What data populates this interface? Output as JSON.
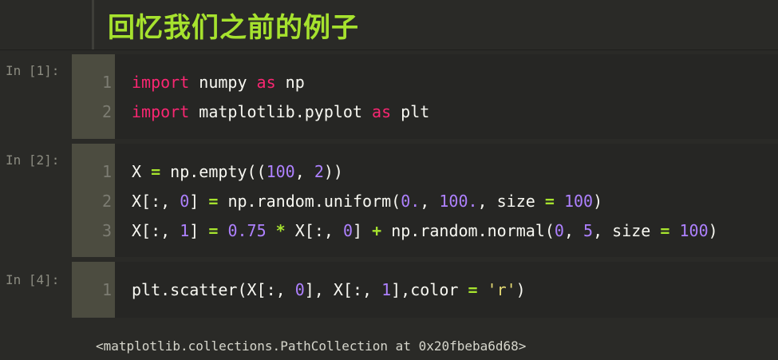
{
  "heading": {
    "text": "回忆我们之前的例子"
  },
  "cells": [
    {
      "prompt": "In [1]:",
      "lines": [
        {
          "n": "1",
          "tokens": [
            {
              "t": "import",
              "c": "kw"
            },
            {
              "t": " numpy ",
              "c": ""
            },
            {
              "t": "as",
              "c": "kw"
            },
            {
              "t": " np",
              "c": ""
            }
          ]
        },
        {
          "n": "2",
          "tokens": [
            {
              "t": "import",
              "c": "kw"
            },
            {
              "t": " matplotlib.pyplot ",
              "c": ""
            },
            {
              "t": "as",
              "c": "kw"
            },
            {
              "t": " plt",
              "c": ""
            }
          ]
        }
      ]
    },
    {
      "prompt": "In [2]:",
      "lines": [
        {
          "n": "1",
          "tokens": [
            {
              "t": "X ",
              "c": ""
            },
            {
              "t": "=",
              "c": "op"
            },
            {
              "t": " np.empty((",
              "c": ""
            },
            {
              "t": "100",
              "c": "num"
            },
            {
              "t": ", ",
              "c": ""
            },
            {
              "t": "2",
              "c": "num"
            },
            {
              "t": "))",
              "c": ""
            }
          ]
        },
        {
          "n": "2",
          "tokens": [
            {
              "t": "X[:, ",
              "c": ""
            },
            {
              "t": "0",
              "c": "num"
            },
            {
              "t": "] ",
              "c": ""
            },
            {
              "t": "=",
              "c": "op"
            },
            {
              "t": " np.random.uniform(",
              "c": ""
            },
            {
              "t": "0.",
              "c": "num"
            },
            {
              "t": ", ",
              "c": ""
            },
            {
              "t": "100.",
              "c": "num"
            },
            {
              "t": ", size ",
              "c": ""
            },
            {
              "t": "=",
              "c": "op"
            },
            {
              "t": " ",
              "c": ""
            },
            {
              "t": "100",
              "c": "num"
            },
            {
              "t": ")",
              "c": ""
            }
          ]
        },
        {
          "n": "3",
          "tokens": [
            {
              "t": "X[:, ",
              "c": ""
            },
            {
              "t": "1",
              "c": "num"
            },
            {
              "t": "] ",
              "c": ""
            },
            {
              "t": "=",
              "c": "op"
            },
            {
              "t": " ",
              "c": ""
            },
            {
              "t": "0.75",
              "c": "num"
            },
            {
              "t": " ",
              "c": ""
            },
            {
              "t": "*",
              "c": "op"
            },
            {
              "t": " X[:, ",
              "c": ""
            },
            {
              "t": "0",
              "c": "num"
            },
            {
              "t": "] ",
              "c": ""
            },
            {
              "t": "+",
              "c": "op"
            },
            {
              "t": " np.random.normal(",
              "c": ""
            },
            {
              "t": "0",
              "c": "num"
            },
            {
              "t": ", ",
              "c": ""
            },
            {
              "t": "5",
              "c": "num"
            },
            {
              "t": ", size ",
              "c": ""
            },
            {
              "t": "=",
              "c": "op"
            },
            {
              "t": " ",
              "c": ""
            },
            {
              "t": "100",
              "c": "num"
            },
            {
              "t": ")",
              "c": ""
            }
          ]
        }
      ]
    },
    {
      "prompt": "In [4]:",
      "lines": [
        {
          "n": "1",
          "tokens": [
            {
              "t": "plt.scatter(X[:, ",
              "c": ""
            },
            {
              "t": "0",
              "c": "num"
            },
            {
              "t": "], X[:, ",
              "c": ""
            },
            {
              "t": "1",
              "c": "num"
            },
            {
              "t": "],color ",
              "c": ""
            },
            {
              "t": "=",
              "c": "op"
            },
            {
              "t": " ",
              "c": ""
            },
            {
              "t": "'r'",
              "c": "str"
            },
            {
              "t": ")",
              "c": ""
            }
          ]
        }
      ]
    }
  ],
  "output": {
    "text": "<matplotlib.collections.PathCollection at 0x20fbeba6d68>"
  },
  "colors": {
    "keyword": "#f92672",
    "operator": "#a6e22e",
    "number": "#ae81ff",
    "string": "#e6db74",
    "heading": "#a6e22e"
  }
}
